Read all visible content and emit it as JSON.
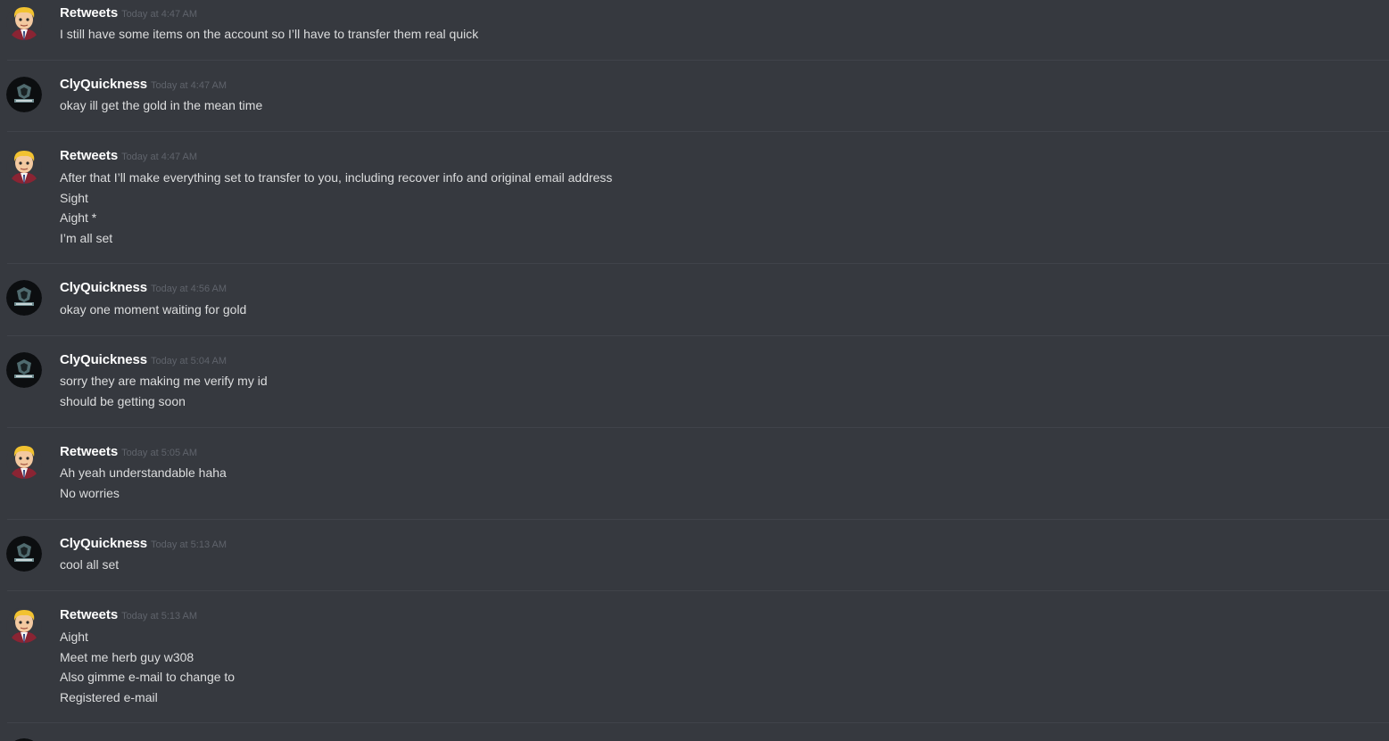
{
  "messages": [
    {
      "author": "Retweets",
      "avatar_icon": "cartoon-man-avatar-icon",
      "time": "Today at 4:47 AM",
      "lines": [
        "I still have some items on the account so I’ll have to transfer them real quick"
      ]
    },
    {
      "author": "ClyQuickness",
      "avatar_icon": "dark-clan-logo-avatar-icon",
      "time": "Today at 4:47 AM",
      "lines": [
        "okay ill get the gold in the mean time"
      ]
    },
    {
      "author": "Retweets",
      "avatar_icon": "cartoon-man-avatar-icon",
      "time": "Today at 4:47 AM",
      "lines": [
        "After that I’ll make everything set to transfer to you, including recover info and original email address",
        "Sight",
        "Aight *",
        "I’m all set"
      ]
    },
    {
      "author": "ClyQuickness",
      "avatar_icon": "dark-clan-logo-avatar-icon",
      "time": "Today at 4:56 AM",
      "lines": [
        "okay one moment waiting for gold"
      ]
    },
    {
      "author": "ClyQuickness",
      "avatar_icon": "dark-clan-logo-avatar-icon",
      "time": "Today at 5:04 AM",
      "lines": [
        "sorry they are making me verify my id",
        "should be getting soon"
      ]
    },
    {
      "author": "Retweets",
      "avatar_icon": "cartoon-man-avatar-icon",
      "time": "Today at 5:05 AM",
      "lines": [
        "Ah yeah understandable haha",
        "No worries"
      ]
    },
    {
      "author": "ClyQuickness",
      "avatar_icon": "dark-clan-logo-avatar-icon",
      "time": "Today at 5:13 AM",
      "lines": [
        "cool all set"
      ]
    },
    {
      "author": "Retweets",
      "avatar_icon": "cartoon-man-avatar-icon",
      "time": "Today at 5:13 AM",
      "lines": [
        "Aight",
        "Meet me herb guy w308",
        "Also gimme e-mail to change to",
        "Registered e-mail"
      ]
    }
  ],
  "colors": {
    "background": "#36393f",
    "divider": "#40434a",
    "username": "#ffffff",
    "timestamp": "#5f636b",
    "message_text": "#dcddde"
  }
}
